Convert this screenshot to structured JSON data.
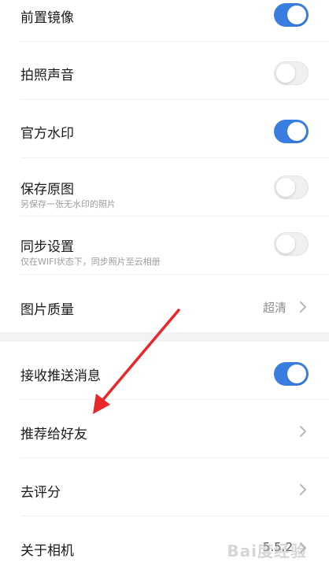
{
  "group1": {
    "front_mirror": {
      "label": "前置镜像",
      "toggle": "on"
    },
    "shutter_sound": {
      "label": "拍照声音",
      "toggle": "off"
    },
    "official_watermark": {
      "label": "官方水印",
      "toggle": "on"
    },
    "save_original": {
      "label": "保存原图",
      "subtitle": "另保存一张无水印的照片",
      "toggle": "off"
    },
    "sync_settings": {
      "label": "同步设置",
      "subtitle": "仅在WIFI状态下，同步照片至云相册",
      "toggle": "off"
    },
    "image_quality": {
      "label": "图片质量",
      "value": "超清",
      "icon": "chevron-right-icon"
    }
  },
  "group2": {
    "push_messages": {
      "label": "接收推送消息",
      "toggle": "on"
    },
    "recommend_friends": {
      "label": "推荐给好友",
      "icon": "chevron-right-icon"
    },
    "rate": {
      "label": "去评分",
      "icon": "chevron-right-icon"
    },
    "about": {
      "label": "关于相机",
      "value": "5.5.2",
      "icon": "chevron-right-icon"
    }
  },
  "annotation": {
    "color": "#e8262b",
    "icon": "red-arrow-annotation"
  },
  "watermark": {
    "text": "Bai度经验"
  },
  "colors": {
    "accent": "#3a7de0",
    "divider": "#efefef",
    "gap": "#f2f3f5"
  }
}
